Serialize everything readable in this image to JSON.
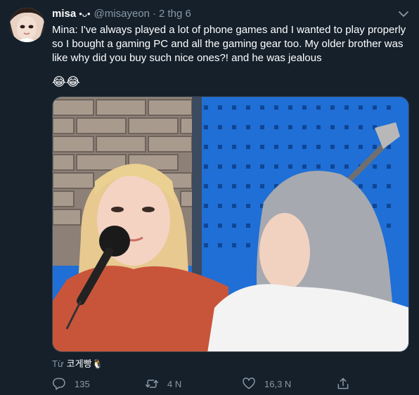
{
  "tweet": {
    "display_name": "misa",
    "name_emoji": "•ᴗ•",
    "handle": "@misayeon",
    "separator": "·",
    "date": "2 thg 6",
    "text": "Mina: I've always played a lot of phone games and I wanted to play properly so I bought a gaming PC and all the gaming gear too. My older brother was like why did you buy such nice ones?! and he was jealous",
    "emoji_line": "😂😂",
    "from_prefix": "Từ",
    "from_source": "코게빵🐧"
  },
  "actions": {
    "reply_count": "135",
    "retweet_count": "4 N",
    "like_count": "16,3 N"
  },
  "icons": {
    "more": "chevron-down-icon",
    "reply": "reply-icon",
    "retweet": "retweet-icon",
    "like": "heart-icon",
    "share": "share-icon"
  },
  "colors": {
    "background": "#15202b",
    "secondary_text": "#8899a6",
    "border": "#38444d"
  }
}
